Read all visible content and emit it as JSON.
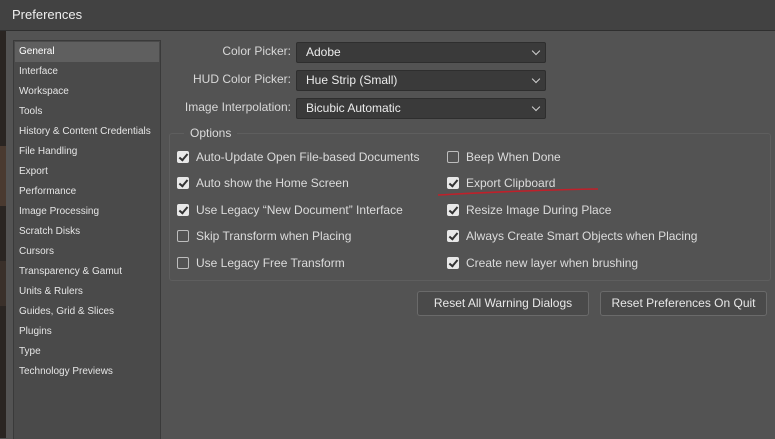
{
  "window": {
    "title": "Preferences"
  },
  "sidebar": {
    "items": [
      {
        "label": "General",
        "active": true
      },
      {
        "label": "Interface"
      },
      {
        "label": "Workspace"
      },
      {
        "label": "Tools"
      },
      {
        "label": "History & Content Credentials"
      },
      {
        "label": "File Handling"
      },
      {
        "label": "Export"
      },
      {
        "label": "Performance"
      },
      {
        "label": "Image Processing"
      },
      {
        "label": "Scratch Disks"
      },
      {
        "label": "Cursors"
      },
      {
        "label": "Transparency & Gamut"
      },
      {
        "label": "Units & Rulers"
      },
      {
        "label": "Guides, Grid & Slices"
      },
      {
        "label": "Plugins"
      },
      {
        "label": "Type"
      },
      {
        "label": "Technology Previews"
      }
    ]
  },
  "general": {
    "color_picker": {
      "label": "Color Picker:",
      "value": "Adobe"
    },
    "hud_color_picker": {
      "label": "HUD Color Picker:",
      "value": "Hue Strip (Small)"
    },
    "image_interpolation": {
      "label": "Image Interpolation:",
      "value": "Bicubic Automatic"
    }
  },
  "options": {
    "title": "Options",
    "left": [
      {
        "label": "Auto-Update Open File-based Documents",
        "checked": true
      },
      {
        "label": "Auto show the Home Screen",
        "checked": true
      },
      {
        "label": "Use Legacy “New Document” Interface",
        "checked": true
      },
      {
        "label": "Skip Transform when Placing",
        "checked": false
      },
      {
        "label": "Use Legacy Free Transform",
        "checked": false
      }
    ],
    "right": [
      {
        "label": "Beep When Done",
        "checked": false
      },
      {
        "label": "Export Clipboard",
        "checked": true
      },
      {
        "label": "Resize Image During Place",
        "checked": true
      },
      {
        "label": "Always Create Smart Objects when Placing",
        "checked": true
      },
      {
        "label": "Create new layer when brushing",
        "checked": true
      }
    ]
  },
  "buttons": {
    "reset_warnings": "Reset All Warning Dialogs",
    "reset_prefs": "Reset Preferences On Quit"
  },
  "colors": {
    "background": "#535353",
    "annotation_underline": "#c0202a"
  }
}
